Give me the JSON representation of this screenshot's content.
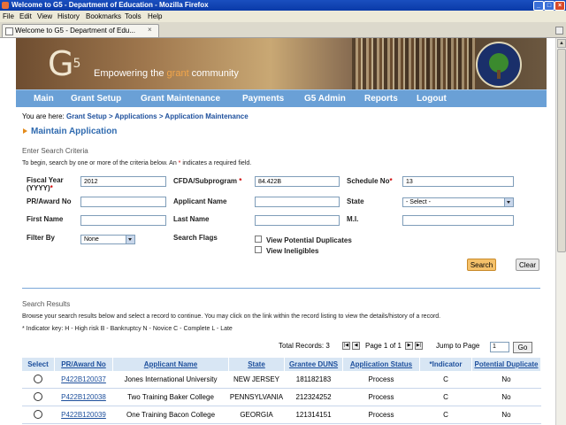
{
  "window": {
    "title": "Welcome to G5 - Department of Education - Mozilla Firefox",
    "min": "_",
    "max": "□",
    "close": "×"
  },
  "menu": [
    "File",
    "Edit",
    "View",
    "History",
    "Bookmarks",
    "Tools",
    "Help"
  ],
  "tab": {
    "label": "Welcome to G5 - Department of Edu...",
    "close": "×"
  },
  "banner": {
    "logo": "G",
    "logo_sup": "5",
    "tagline_pre": "Empowering the ",
    "tagline_hl": "grant",
    "tagline_post": " community"
  },
  "nav": [
    "Main",
    "Grant Setup",
    "Grant Maintenance",
    "Payments",
    "G5 Admin",
    "Reports",
    "Logout"
  ],
  "breadcrumb": {
    "prefix": "You are here: ",
    "items": [
      "Grant Setup",
      "Applications",
      "Application Maintenance"
    ],
    "sep": " > "
  },
  "page_title": "Maintain Application",
  "search": {
    "heading": "Enter Search Criteria",
    "instructions_pre": "To begin, search by one or more of the criteria below. An ",
    "instructions_star": "*",
    "instructions_post": " indicates a required field.",
    "fields": {
      "fiscal_year": {
        "label": "Fiscal Year (YYYY)",
        "value": "2012"
      },
      "cfda": {
        "label": "CFDA/Subprogram",
        "value": "84.422B"
      },
      "schedule": {
        "label": "Schedule No",
        "value": "13"
      },
      "pr_award": {
        "label": "PR/Award No",
        "value": ""
      },
      "applicant_name": {
        "label": "Applicant Name",
        "value": ""
      },
      "state": {
        "label": "State",
        "value": "- Select -"
      },
      "first_name": {
        "label": "First Name",
        "value": ""
      },
      "last_name": {
        "label": "Last Name",
        "value": ""
      },
      "mi": {
        "label": "M.I.",
        "value": ""
      },
      "filter_by": {
        "label": "Filter By",
        "value": "None"
      },
      "search_flags": {
        "label": "Search Flags"
      },
      "view_duplicates": {
        "label": "View Potential Duplicates",
        "checked": false
      },
      "view_ineligibles": {
        "label": "View Ineligibles",
        "checked": false
      }
    },
    "required_star": "*",
    "search_button": "Search",
    "clear_button": "Clear"
  },
  "results": {
    "heading": "Search Results",
    "instructions": "Browse your search results below and select a record to continue. You may click on the link within the record listing to view the details/history of a record.",
    "indicator_key": "* Indicator key: H - High risk B - Bankruptcy N - Novice C - Complete L - Late",
    "total_records": "Total Records: 3",
    "page_info": "Page 1 of 1",
    "jump_label": "Jump to Page",
    "jump_value": "1",
    "go_button": "Go",
    "columns": [
      "Select",
      "PR/Award No",
      "Applicant Name",
      "State",
      "Grantee DUNS",
      "Application Status",
      "*Indicator",
      "Potential Duplicate"
    ],
    "rows": [
      {
        "award": "P422B120037",
        "applicant": "Jones International University",
        "state": "NEW JERSEY",
        "duns": "181182183",
        "status": "Process",
        "indicator": "C",
        "duplicate": "No"
      },
      {
        "award": "P422B120038",
        "applicant": "Two Training Baker College",
        "state": "PENNSYLVANIA",
        "duns": "212324252",
        "status": "Process",
        "indicator": "C",
        "duplicate": "No"
      },
      {
        "award": "P422B120039",
        "applicant": "One Training Bacon College",
        "state": "GEORGIA",
        "duns": "121314151",
        "status": "Process",
        "indicator": "C",
        "duplicate": "No"
      }
    ]
  }
}
